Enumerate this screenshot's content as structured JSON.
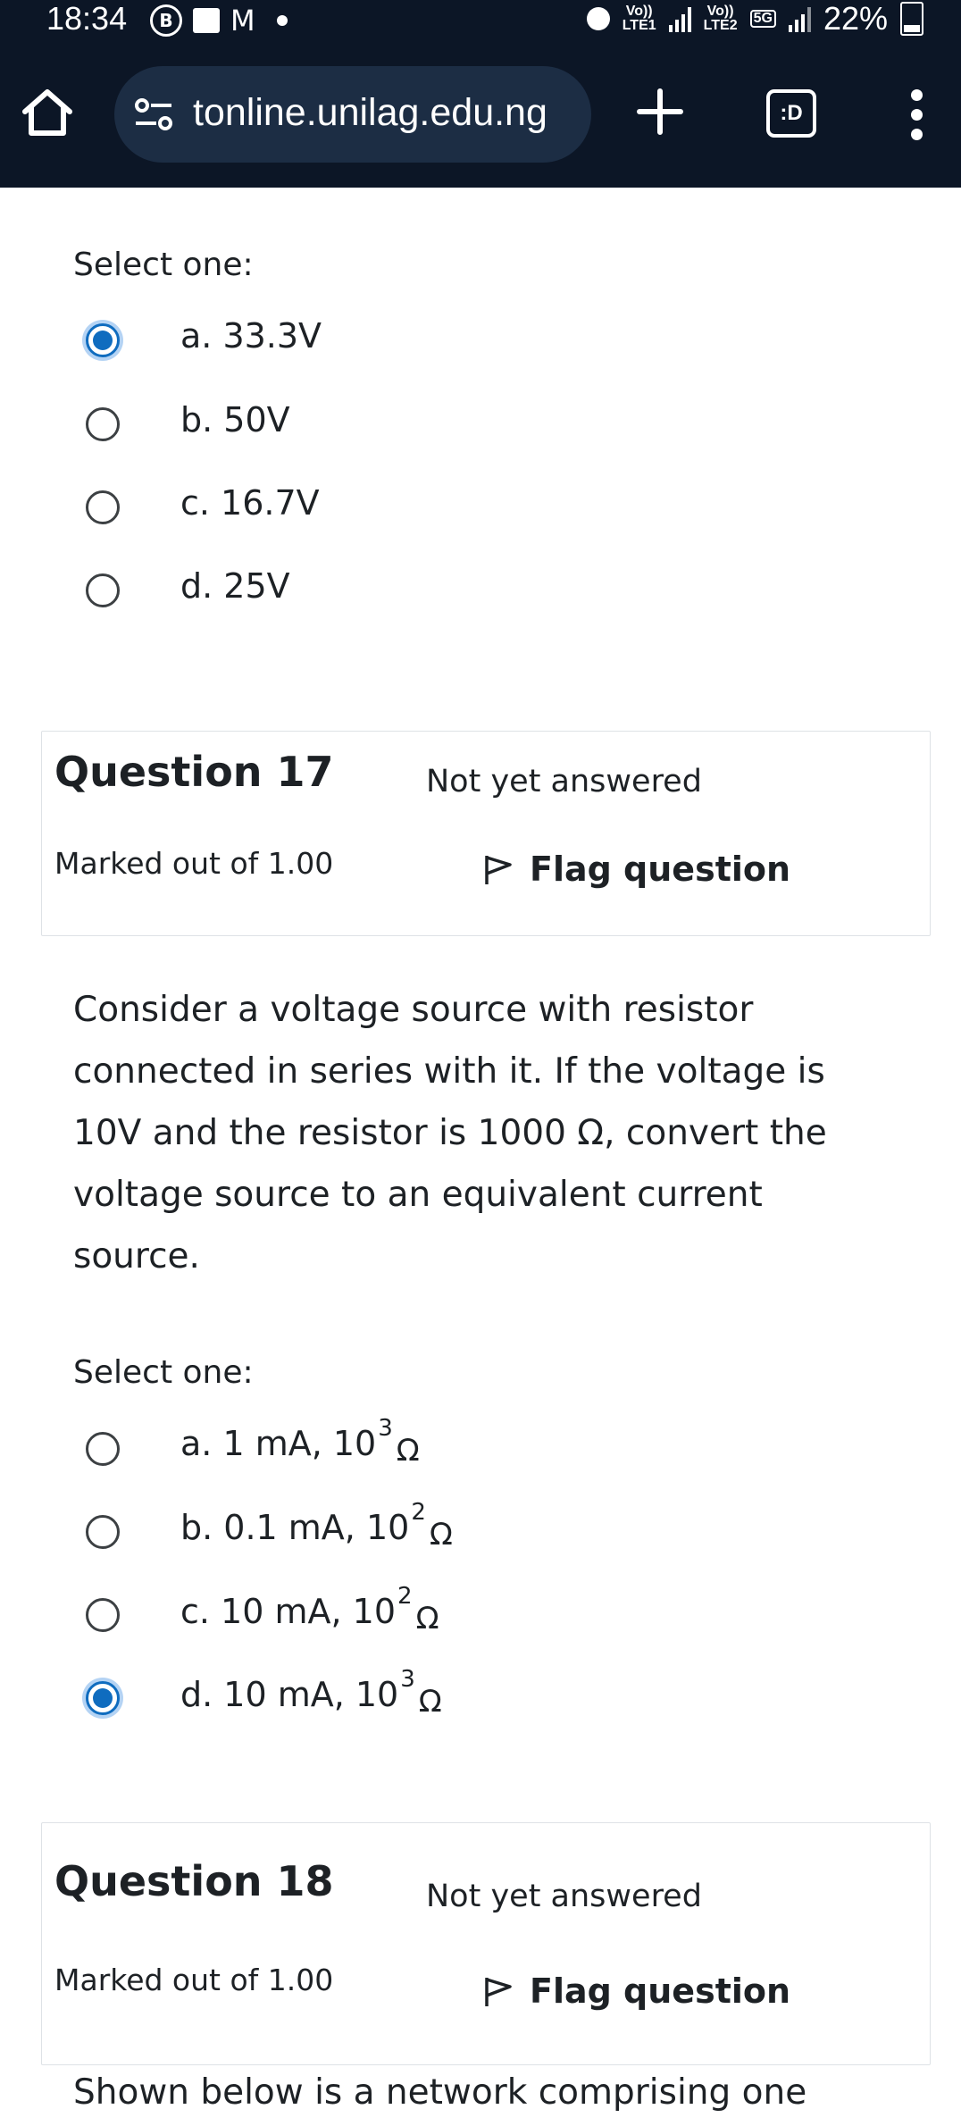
{
  "status_bar": {
    "time": "18:34",
    "net1": "Vo))\nLTE1",
    "net2": "Vo))\nLTE2",
    "net_5g": "5G",
    "battery": "22%"
  },
  "browser": {
    "url": "tonline.unilag.edu.ng",
    "tabs_label": ":D"
  },
  "prev_question": {
    "select_one": "Select one:",
    "options": [
      {
        "label": "a. 33.3V",
        "checked": true
      },
      {
        "label": "b. 50V",
        "checked": false
      },
      {
        "label": "c. 16.7V",
        "checked": false
      },
      {
        "label": "d. 25V",
        "checked": false
      }
    ]
  },
  "q17": {
    "title": "Question 17",
    "status": "Not yet answered",
    "marked": "Marked out of 1.00",
    "flag": "Flag question",
    "text": "Consider a voltage source with resistor connected in series with it. If the voltage is 10V and the resistor is 1000 Ω, convert the voltage source to an equivalent current source.",
    "select_one": "Select one:",
    "options": [
      {
        "prefix": "a. 1 mA, 10",
        "exp": "3",
        "unit": "Ω",
        "checked": false
      },
      {
        "prefix": "b. 0.1 mA, 10",
        "exp": "2",
        "unit": "Ω",
        "checked": false
      },
      {
        "prefix": "c. 10 mA, 10",
        "exp": "2",
        "unit": "Ω",
        "checked": false
      },
      {
        "prefix": "d. 10 mA, 10",
        "exp": "3",
        "unit": "Ω",
        "checked": true
      }
    ]
  },
  "q18": {
    "title": "Question 18",
    "status": "Not yet answered",
    "marked": "Marked out of 1.00",
    "flag": "Flag question",
    "text_partial": "Shown below is a network comprising one"
  },
  "colors": {
    "accent": "#0f6cbf",
    "topbar": "#0c1626",
    "urlpill": "#1c2d44"
  }
}
